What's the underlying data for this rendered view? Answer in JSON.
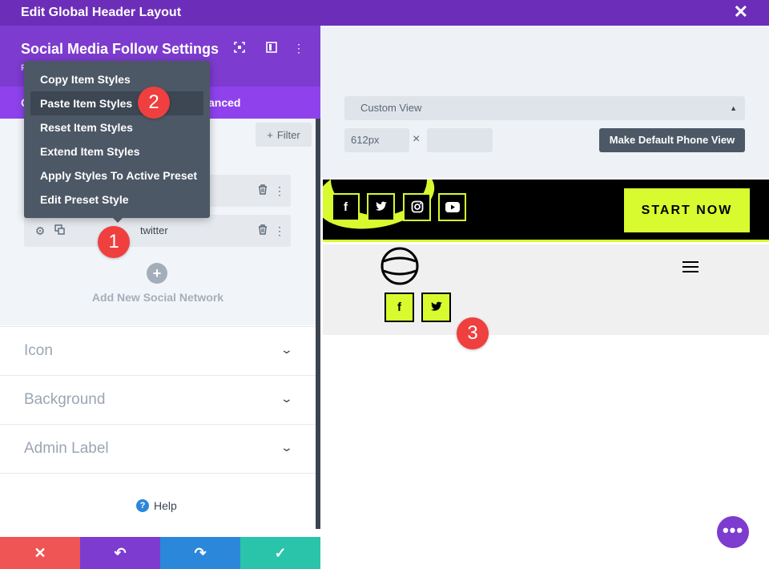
{
  "window": {
    "title": "Edit Global Header Layout"
  },
  "panel": {
    "title": "Social Media Follow Settings",
    "subtitle": "P",
    "tab_content_fragment": "C",
    "tab_advanced_fragment": "anced",
    "filter_label": "Filter",
    "items": [
      {
        "label": ""
      },
      {
        "label": "twitter"
      }
    ],
    "add_label": "Add New Social Network",
    "sections": [
      "Icon",
      "Background",
      "Admin Label"
    ],
    "help_label": "Help"
  },
  "context_menu": {
    "items": [
      "Copy Item Styles",
      "Paste Item Styles",
      "Reset Item Styles",
      "Extend Item Styles",
      "Apply Styles To Active Preset",
      "Edit Preset Style"
    ],
    "active_index": 1
  },
  "badges": [
    "1",
    "2",
    "3"
  ],
  "viewport": {
    "view_select": "Custom View",
    "width_value": "612px",
    "height_value": "",
    "separator": "×",
    "default_button": "Make Default Phone View"
  },
  "preview": {
    "social_icons_header": [
      "f",
      "t",
      "ig",
      "yt"
    ],
    "cta_label": "START NOW",
    "social_icons_body": [
      "f",
      "t"
    ]
  },
  "colors": {
    "purple_dark": "#6c2eb9",
    "purple": "#7d3bcf",
    "lime": "#d8fb2f",
    "red": "#ef5555",
    "blue": "#2b87da",
    "teal": "#29c4a9"
  }
}
